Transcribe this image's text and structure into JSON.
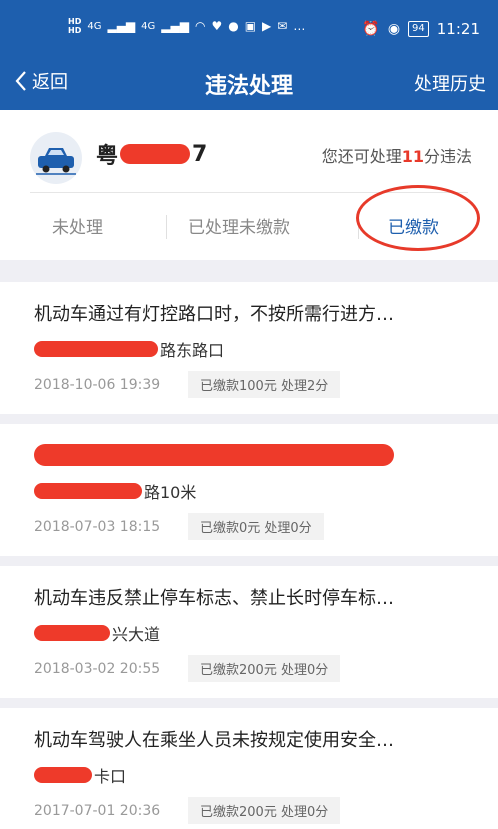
{
  "status_bar": {
    "network_1": "4G",
    "network_2": "4G",
    "battery": "94",
    "time": "11:21"
  },
  "nav": {
    "back_label": "返回",
    "title": "违法处理",
    "history_label": "处理历史"
  },
  "vehicle": {
    "plate_prefix": "粤",
    "plate_suffix": "7",
    "points_prefix": "您还可处理",
    "points_value": "11",
    "points_suffix": "分违法"
  },
  "tabs": [
    {
      "label": "未处理",
      "active": false
    },
    {
      "label": "已处理未缴款",
      "active": false
    },
    {
      "label": "已缴款",
      "active": true
    }
  ],
  "violations": [
    {
      "title": "机动车通过有灯控路口时，不按所需行进方…",
      "address": "路东路口",
      "date": "2018-10-06 19:39",
      "status": "已缴款100元 处理2分"
    },
    {
      "title": "",
      "address": "路10米",
      "date": "2018-07-03 18:15",
      "status": "已缴款0元 处理0分"
    },
    {
      "title": "机动车违反禁止停车标志、禁止长时停车标…",
      "address": "兴大道",
      "date": "2018-03-02 20:55",
      "status": "已缴款200元 处理0分"
    },
    {
      "title": "机动车驾驶人在乘坐人员未按规定使用安全…",
      "address": "卡口",
      "date": "2017-07-01 20:36",
      "status": "已缴款200元 处理0分"
    }
  ],
  "colors": {
    "brand": "#1e5fae",
    "highlight": "#e8392a"
  }
}
